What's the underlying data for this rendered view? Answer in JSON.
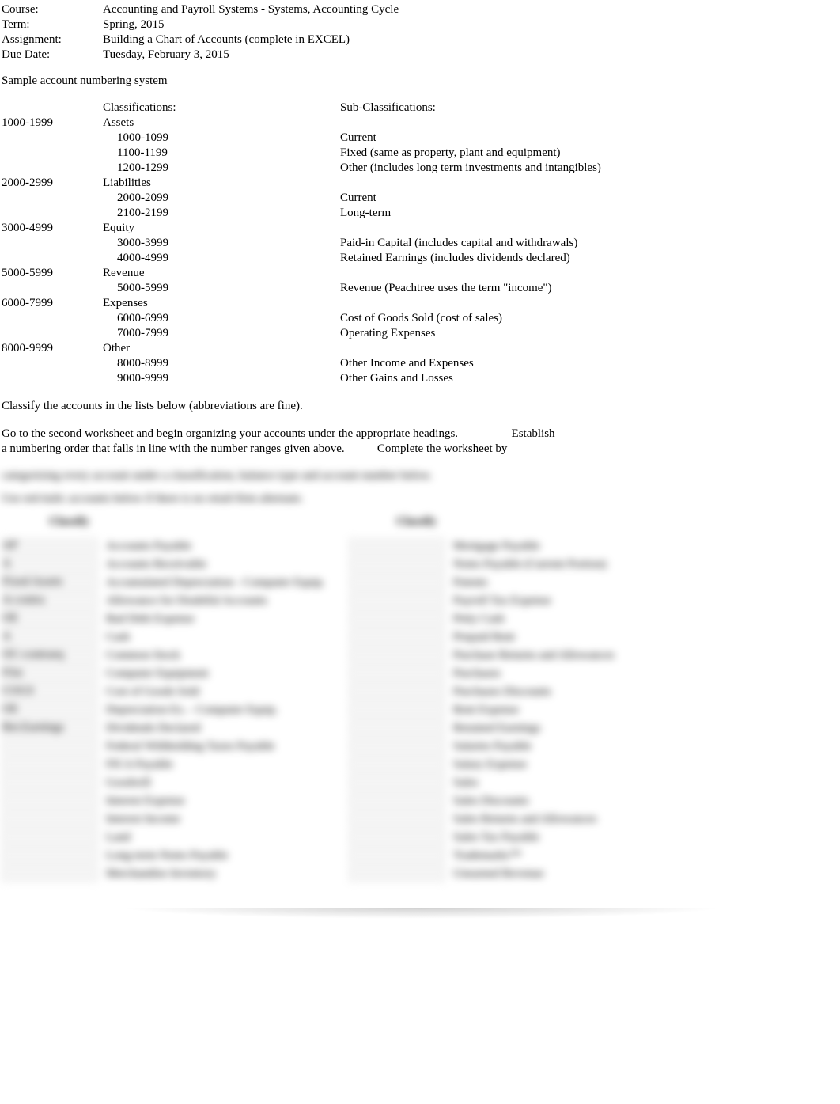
{
  "header": {
    "course_label": "Course:",
    "course_value": "Accounting and Payroll Systems - Systems, Accounting Cycle",
    "term_label": "Term:",
    "term_value": "Spring, 2015",
    "assignment_label": "Assignment:",
    "assignment_value": "Building a Chart of Accounts (complete in EXCEL)",
    "due_label": "Due Date:",
    "due_value": "Tuesday, February 3, 2015"
  },
  "sample_heading": "Sample account numbering system",
  "headers": {
    "classifications": "Classifications:",
    "subclassifications": "Sub-Classifications:"
  },
  "numbering": [
    {
      "range": "1000-1999",
      "class": "Assets",
      "subs": [
        {
          "r": "1000-1099",
          "d": "Current"
        },
        {
          "r": "1100-1199",
          "d": "Fixed (same as property, plant and equipment)"
        },
        {
          "r": "1200-1299",
          "d": "Other (includes long term investments and intangibles)"
        }
      ]
    },
    {
      "range": "2000-2999",
      "class": "Liabilities",
      "subs": [
        {
          "r": "2000-2099",
          "d": "Current"
        },
        {
          "r": "2100-2199",
          "d": "Long-term"
        }
      ]
    },
    {
      "range": "3000-4999",
      "class": "Equity",
      "subs": [
        {
          "r": "3000-3999",
          "d": "Paid-in Capital (includes capital and withdrawals)"
        },
        {
          "r": "4000-4999",
          "d": "Retained Earnings (includes dividends declared)"
        }
      ]
    },
    {
      "range": "5000-5999",
      "class": "Revenue",
      "subs": [
        {
          "r": "5000-5999",
          "d": "Revenue (Peachtree uses the term \"income\")"
        }
      ]
    },
    {
      "range": "6000-7999",
      "class": "Expenses",
      "subs": [
        {
          "r": "6000-6999",
          "d": "Cost of Goods Sold (cost of sales)"
        },
        {
          "r": "7000-7999",
          "d": "Operating Expenses"
        }
      ]
    },
    {
      "range": "8000-9999",
      "class": "Other",
      "subs": [
        {
          "r": "8000-8999",
          "d": "Other Income and Expenses"
        },
        {
          "r": "9000-9999",
          "d": "Other Gains and Losses"
        }
      ]
    }
  ],
  "instructions": {
    "l1": "Classify the accounts in the lists below (abbreviations are fine).",
    "l2": "Go to the second worksheet and begin organizing your accounts under the appropriate headings.                  Establish",
    "l3": "a numbering order that falls in line with the number ranges given above.           Complete the worksheet by"
  },
  "blurred": {
    "hint1": "categorizing every account under a classification, balance type and account number below.",
    "hint2": "Use red-italic accounts below if there is no retail-firm alternate.",
    "classify": "Classify",
    "accounts_left": [
      {
        "code": "AP",
        "name": "Accounts Payable"
      },
      {
        "code": "A",
        "name": "Accounts Receivable"
      },
      {
        "code": "Fixed Assets",
        "name": "Accumulated Depreciation - Computer Equip."
      },
      {
        "code": "A-contra",
        "name": "Allowance for Doubtful Accounts"
      },
      {
        "code": "OE",
        "name": "Bad Debt Expense"
      },
      {
        "code": "A",
        "name": "Cash"
      },
      {
        "code": "OC-contraeq",
        "name": "Common Stock"
      },
      {
        "code": "FAn",
        "name": "Computer Equipment"
      },
      {
        "code": "COGS",
        "name": "Cost of Goods Sold"
      },
      {
        "code": "OE",
        "name": "Depreciation Ex. - Computer Equip."
      },
      {
        "code": "Ret.Earnings",
        "name": "Dividends Declared"
      },
      {
        "code": "",
        "name": "Federal Withholding Taxes Payable"
      },
      {
        "code": "",
        "name": "FICA Payable"
      },
      {
        "code": "",
        "name": "Goodwill"
      },
      {
        "code": "",
        "name": "Interest Expense"
      },
      {
        "code": "",
        "name": "Interest Income"
      },
      {
        "code": "",
        "name": "Land"
      },
      {
        "code": "",
        "name": "Long-term Notes Payable"
      },
      {
        "code": "",
        "name": "Merchandise Inventory"
      }
    ],
    "accounts_right": [
      {
        "code": "",
        "name": "Mortgage Payable"
      },
      {
        "code": "",
        "name": "Notes Payable (Current Portion)"
      },
      {
        "code": "",
        "name": "Patents"
      },
      {
        "code": "",
        "name": "Payroll Tax Expense"
      },
      {
        "code": "",
        "name": "Petty Cash"
      },
      {
        "code": "",
        "name": "Prepaid Rent"
      },
      {
        "code": "",
        "name": "Purchase Returns and Allowances"
      },
      {
        "code": "",
        "name": "Purchases"
      },
      {
        "code": "",
        "name": "Purchases Discounts"
      },
      {
        "code": "",
        "name": "Rent Expense"
      },
      {
        "code": "",
        "name": "Retained Earnings"
      },
      {
        "code": "",
        "name": "Salaries Payable"
      },
      {
        "code": "",
        "name": "Salary Expense"
      },
      {
        "code": "",
        "name": "Sales"
      },
      {
        "code": "",
        "name": "Sales Discounts"
      },
      {
        "code": "",
        "name": "Sales Returns and Allowances"
      },
      {
        "code": "",
        "name": "Sales Tax Payable"
      },
      {
        "code": "",
        "name": "Trademarks™"
      },
      {
        "code": "",
        "name": "Unearned Revenue"
      }
    ]
  }
}
